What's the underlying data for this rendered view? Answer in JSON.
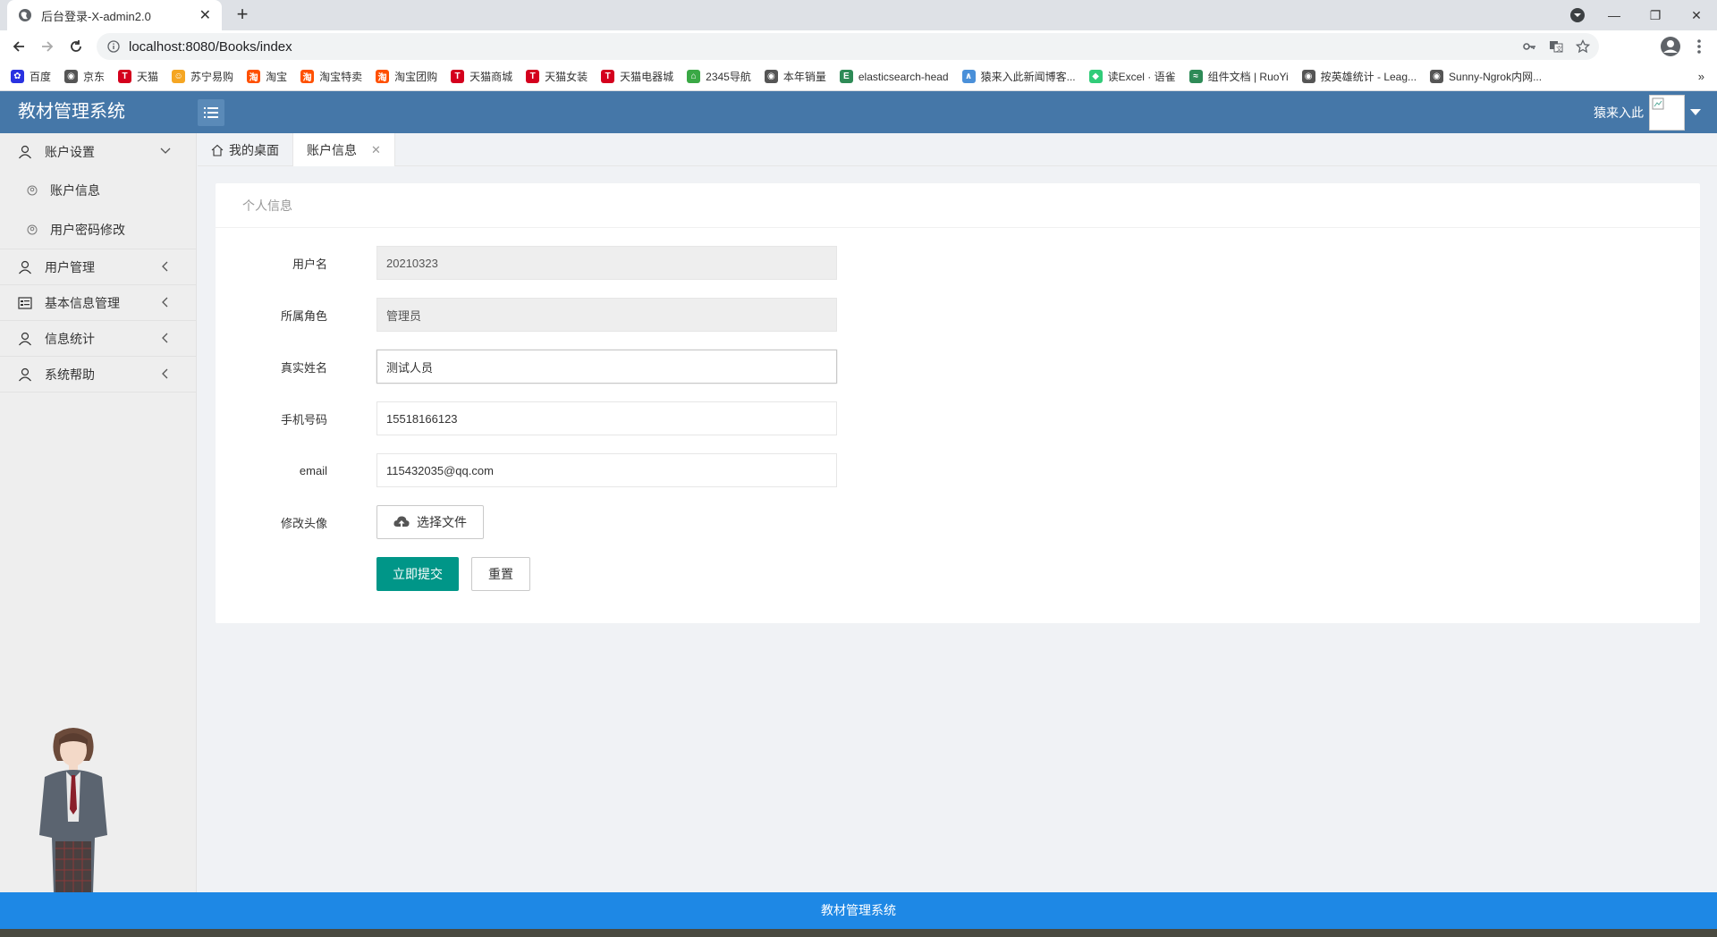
{
  "browser": {
    "tab_title": "后台登录-X-admin2.0",
    "url": "localhost:8080/Books/index",
    "bookmarks": [
      {
        "label": "百度",
        "color": "#2932e1",
        "glyph": "✿"
      },
      {
        "label": "京东",
        "color": "#555555",
        "glyph": "◉"
      },
      {
        "label": "天猫",
        "color": "#d4001d",
        "glyph": "T"
      },
      {
        "label": "苏宁易购",
        "color": "#f5a623",
        "glyph": "☺"
      },
      {
        "label": "淘宝",
        "color": "#ff5000",
        "glyph": "淘"
      },
      {
        "label": "淘宝特卖",
        "color": "#ff5000",
        "glyph": "淘"
      },
      {
        "label": "淘宝团购",
        "color": "#ff5000",
        "glyph": "淘"
      },
      {
        "label": "天猫商城",
        "color": "#d4001d",
        "glyph": "T"
      },
      {
        "label": "天猫女装",
        "color": "#d4001d",
        "glyph": "T"
      },
      {
        "label": "天猫电器城",
        "color": "#d4001d",
        "glyph": "T"
      },
      {
        "label": "2345导航",
        "color": "#3aa845",
        "glyph": "⌂"
      },
      {
        "label": "本年销量",
        "color": "#555555",
        "glyph": "◉"
      },
      {
        "label": "elasticsearch-head",
        "color": "#2e8b57",
        "glyph": "E"
      },
      {
        "label": "猿来入此新闻博客...",
        "color": "#4a90d9",
        "glyph": "∧"
      },
      {
        "label": "读Excel · 语雀",
        "color": "#31cc79",
        "glyph": "◆"
      },
      {
        "label": "组件文档 | RuoYi",
        "color": "#2e8b57",
        "glyph": "≈"
      },
      {
        "label": "按英雄统计 - Leag...",
        "color": "#555555",
        "glyph": "◉"
      },
      {
        "label": "Sunny-Ngrok内网...",
        "color": "#555555",
        "glyph": "◉"
      }
    ],
    "more": "»"
  },
  "header": {
    "logo": "教材管理系统",
    "user_name": "猿来入此"
  },
  "sidebar": {
    "groups": [
      {
        "label": "账户设置",
        "open": true,
        "icon": "user-icon",
        "items": [
          {
            "label": "账户信息"
          },
          {
            "label": "用户密码修改"
          }
        ]
      },
      {
        "label": "用户管理",
        "icon": "user-icon"
      },
      {
        "label": "基本信息管理",
        "icon": "list-icon"
      },
      {
        "label": "信息统计",
        "icon": "user-icon"
      },
      {
        "label": "系统帮助",
        "icon": "user-icon"
      }
    ]
  },
  "page_tabs": [
    {
      "label": "我的桌面",
      "icon": "home-icon"
    },
    {
      "label": "账户信息",
      "active": true,
      "closable": true
    }
  ],
  "card": {
    "title": "个人信息",
    "fields": {
      "username": {
        "label": "用户名",
        "value": "20210323"
      },
      "role": {
        "label": "所属角色",
        "value": "管理员"
      },
      "real_name": {
        "label": "真实姓名",
        "value": "测试人员"
      },
      "phone": {
        "label": "手机号码",
        "value": "15518166123"
      },
      "email": {
        "label": "email",
        "value": "115432035@qq.com"
      },
      "avatar": {
        "label": "修改头像",
        "button": "选择文件"
      }
    },
    "submit": "立即提交",
    "reset": "重置"
  },
  "footer": {
    "text": "教材管理系统"
  },
  "colors": {
    "header_bg": "#4577a8",
    "submit_bg": "#009688",
    "footer_bg": "#1e88e5"
  }
}
